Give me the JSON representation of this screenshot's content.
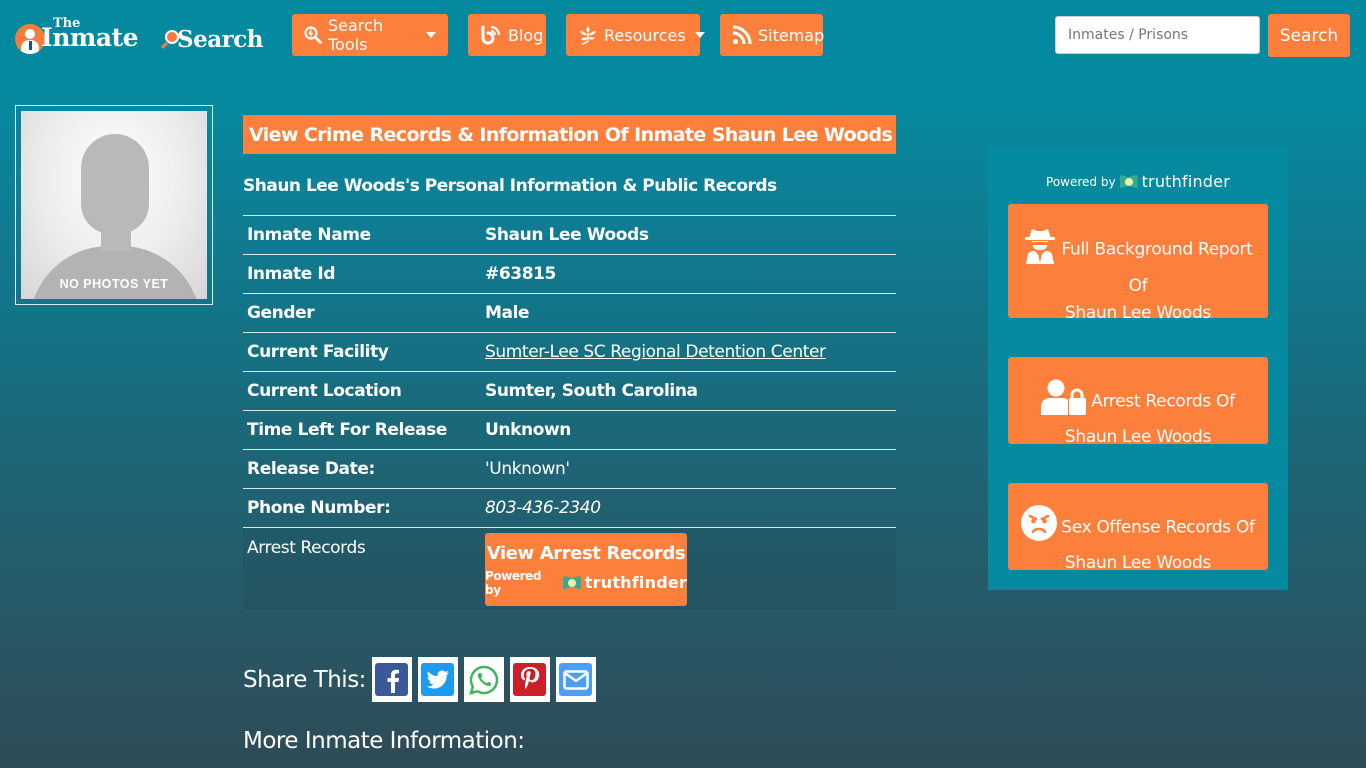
{
  "header": {
    "logo": {
      "the": "The",
      "inmate": "Inmate",
      "search": "Search"
    },
    "nav": [
      {
        "label": "Search Tools",
        "icon": "search-tools-icon",
        "dropdown": true
      },
      {
        "label": "Blog",
        "icon": "blog-icon",
        "dropdown": false
      },
      {
        "label": "Resources",
        "icon": "leaf-icon",
        "dropdown": true
      },
      {
        "label": "Sitemap",
        "icon": "rss-icon",
        "dropdown": false
      }
    ],
    "search": {
      "placeholder": "Inmates / Prisons",
      "value": "",
      "button_label": "Search"
    }
  },
  "photo": {
    "caption": "NO PHOTOS YET"
  },
  "main": {
    "title": "View Crime Records & Information Of Inmate Shaun Lee Woods",
    "subtitle": "Shaun Lee Woods's Personal Information & Public Records",
    "rows": [
      {
        "label": "Inmate Name",
        "value": "Shaun Lee Woods"
      },
      {
        "label": "Inmate Id",
        "value": "#63815"
      },
      {
        "label": "Gender",
        "value": "Male"
      },
      {
        "label": "Current Facility",
        "value": "Sumter-Lee SC Regional Detention Center"
      },
      {
        "label": "Current Location",
        "value": "Sumter, South Carolina"
      },
      {
        "label": "Time Left For Release",
        "value": "Unknown"
      },
      {
        "label": "Release Date:",
        "value": "'Unknown'"
      },
      {
        "label": "Phone Number:",
        "value": "803-436-2340"
      }
    ],
    "arrest": {
      "label": "Arrest Records",
      "button_label": "View Arrest Records",
      "powered_by": "Powered by",
      "brand": "truthfinder"
    }
  },
  "share": {
    "label": "Share This:",
    "buttons": [
      {
        "name": "facebook",
        "color": "#3b5998"
      },
      {
        "name": "twitter",
        "color": "#1d9bf0"
      },
      {
        "name": "whatsapp",
        "color": "#3fb65d"
      },
      {
        "name": "pinterest",
        "color": "#cb2027"
      },
      {
        "name": "email",
        "color": "#4a9ff5"
      }
    ]
  },
  "more_info": "More Inmate Information:",
  "sidebar": {
    "powered_by": "Powered by",
    "brand": "truthfinder",
    "buttons": [
      {
        "line1": "Full Background Report",
        "line2": "Of",
        "line3": "Shaun Lee Woods",
        "icon": "spy-icon"
      },
      {
        "line1": "Arrest Records Of",
        "line2": "Shaun Lee Woods",
        "icon": "user-lock-icon"
      },
      {
        "line1": "Sex Offense Records Of",
        "line2": "Shaun Lee Woods",
        "icon": "angry-face-icon"
      }
    ]
  },
  "colors": {
    "accent": "#fd7f3c",
    "teal": "#058aa0",
    "dark": "#2e4b57"
  }
}
